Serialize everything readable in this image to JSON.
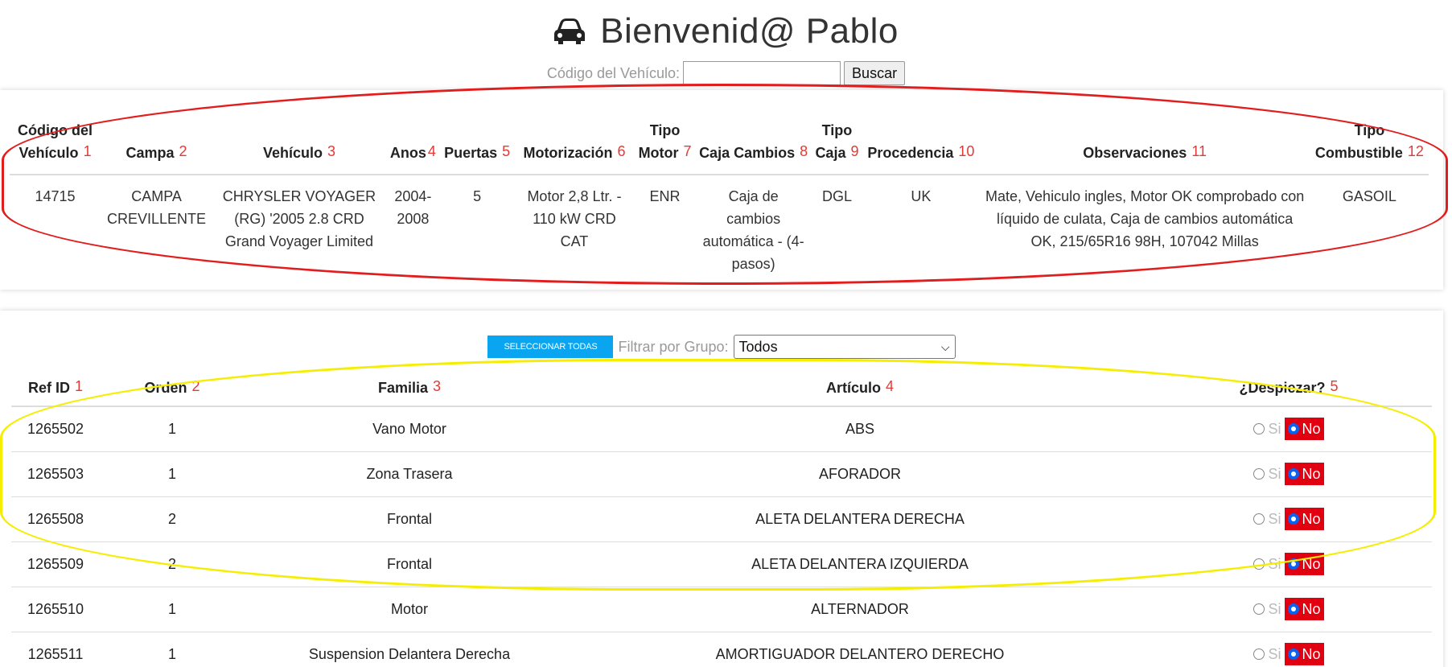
{
  "header": {
    "title": "Bienvenid@ Pablo",
    "search_label": "Código del Vehículo:",
    "search_value": "",
    "search_button": "Buscar"
  },
  "vehicle": {
    "columns": [
      {
        "label": "Código del Vehículo",
        "num": "1"
      },
      {
        "label": "Campa",
        "num": "2"
      },
      {
        "label": "Vehículo",
        "num": "3"
      },
      {
        "label": "Anos",
        "num": "4"
      },
      {
        "label": "Puertas",
        "num": "5"
      },
      {
        "label": "Motorización",
        "num": "6"
      },
      {
        "label": "Tipo Motor",
        "num": "7"
      },
      {
        "label": "Caja Cambios",
        "num": "8"
      },
      {
        "label": "Tipo Caja",
        "num": "9"
      },
      {
        "label": "Procedencia",
        "num": "10"
      },
      {
        "label": "Observaciones",
        "num": "11"
      },
      {
        "label": "Tipo Combustible",
        "num": "12"
      }
    ],
    "row": [
      "14715",
      "CAMPA CREVILLENTE",
      "CHRYSLER VOYAGER (RG) '2005 2.8 CRD Grand Voyager Limited",
      "2004-2008",
      "5",
      "Motor 2,8 Ltr. - 110 kW CRD CAT",
      "ENR",
      "Caja de cambios automática - (4-pasos)",
      "DGL",
      "UK",
      "Mate, Vehiculo ingles, Motor OK comprobado con líquido de culata, Caja de cambios automática OK, 215/65R16 98H, 107042 Millas",
      "GASOIL"
    ]
  },
  "controls": {
    "select_all": "SELECCIONAR TODAS",
    "filter_label": "Filtrar por Grupo:",
    "filter_value": "Todos"
  },
  "parts": {
    "columns": [
      {
        "label": "Ref ID",
        "num": "1"
      },
      {
        "label": "Orden",
        "num": "2"
      },
      {
        "label": "Familia",
        "num": "3"
      },
      {
        "label": "Artículo",
        "num": "4"
      },
      {
        "label": "¿Despiezar?",
        "num": "5"
      }
    ],
    "option_si": "Si",
    "option_no": "No",
    "rows": [
      {
        "ref": "1265502",
        "orden": "1",
        "familia": "Vano Motor",
        "articulo": "ABS",
        "despiezar": "No"
      },
      {
        "ref": "1265503",
        "orden": "1",
        "familia": "Zona Trasera",
        "articulo": "AFORADOR",
        "despiezar": "No"
      },
      {
        "ref": "1265508",
        "orden": "2",
        "familia": "Frontal",
        "articulo": "ALETA DELANTERA DERECHA",
        "despiezar": "No"
      },
      {
        "ref": "1265509",
        "orden": "2",
        "familia": "Frontal",
        "articulo": "ALETA DELANTERA IZQUIERDA",
        "despiezar": "No"
      },
      {
        "ref": "1265510",
        "orden": "1",
        "familia": "Motor",
        "articulo": "ALTERNADOR",
        "despiezar": "No"
      },
      {
        "ref": "1265511",
        "orden": "1",
        "familia": "Suspension Delantera Derecha",
        "articulo": "AMORTIGUADOR DELANTERO DERECHO",
        "despiezar": "No"
      }
    ]
  },
  "colors": {
    "annotation_red": "#e21d1d",
    "annotation_yellow": "#f5ee00",
    "select_button": "#0aa5f0",
    "no_highlight": "#e0000f"
  }
}
